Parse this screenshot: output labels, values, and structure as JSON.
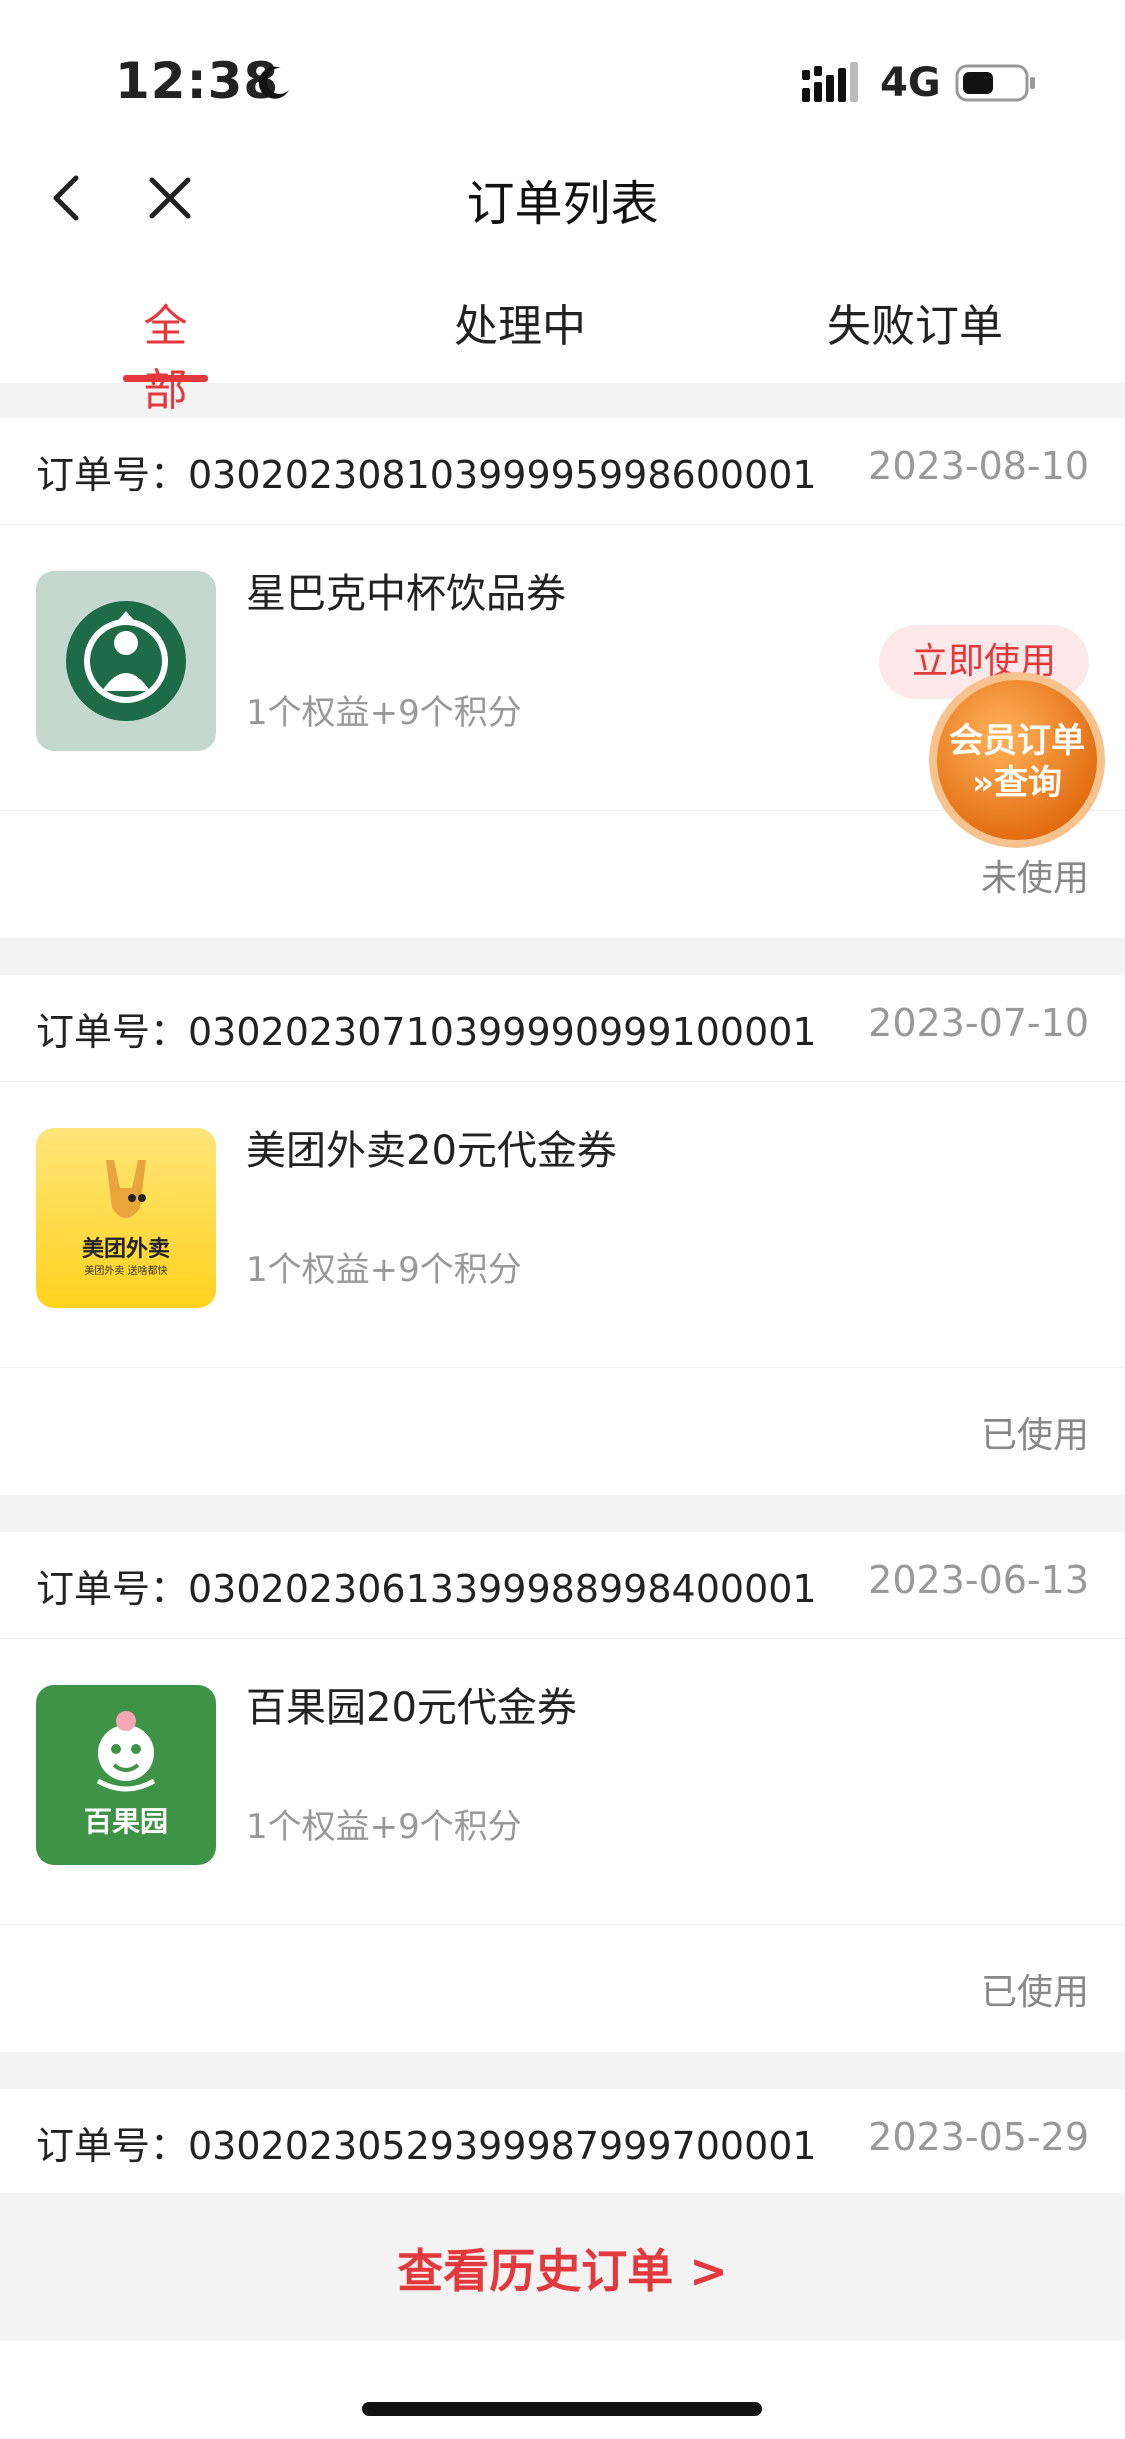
{
  "status_bar": {
    "time": "12:38",
    "network": "4G"
  },
  "nav": {
    "title": "订单列表"
  },
  "tabs": [
    {
      "label": "全部"
    },
    {
      "label": "处理中"
    },
    {
      "label": "失败订单"
    }
  ],
  "orders": [
    {
      "order_no": "订单号：03020230810399995998600001",
      "date": "2023-08-10",
      "name": "星巴克中杯饮品券",
      "desc": "1个权益+9个积分",
      "action": "立即使用",
      "status": "未使用"
    },
    {
      "order_no": "订单号：03020230710399990999100001",
      "date": "2023-07-10",
      "name": "美团外卖20元代金券",
      "desc": "1个权益+9个积分",
      "status": "已使用",
      "logo_text": "美团外卖",
      "logo_sub": "美团外卖 送啥都快"
    },
    {
      "order_no": "订单号：03020230613399988998400001",
      "date": "2023-06-13",
      "name": "百果园20元代金券",
      "desc": "1个权益+9个积分",
      "status": "已使用",
      "logo_text": "百果园"
    },
    {
      "order_no": "订单号：03020230529399987999700001",
      "date": "2023-05-29"
    }
  ],
  "float_badge": {
    "line1": "会员订单",
    "line2": "»查询"
  },
  "history_link": "查看历史订单 >",
  "colors": {
    "accent": "#e4393c",
    "starbucks": "#1e6b4a",
    "meituan": "#ffd51e",
    "pagoda": "#3f9347",
    "badge": "#ef7f1a"
  }
}
